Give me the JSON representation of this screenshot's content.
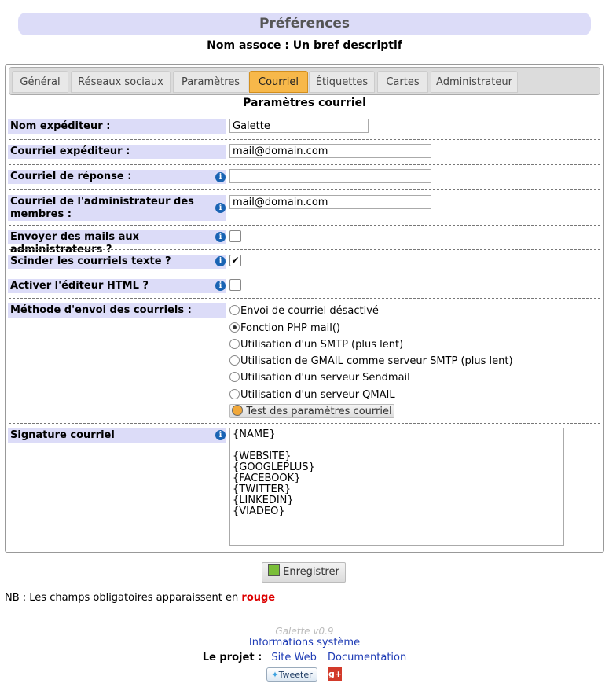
{
  "header": {
    "title": "Préférences",
    "assoc": "Nom assoce : Un bref descriptif"
  },
  "tabs": [
    "Général",
    "Réseaux sociaux",
    "Paramètres",
    "Courriel",
    "Étiquettes",
    "Cartes",
    "Administrateur"
  ],
  "active_tab": "Courriel",
  "section_title": "Paramètres courriel",
  "fields": {
    "sender_name": {
      "label": "Nom expéditeur :",
      "value": "Galette"
    },
    "sender_email": {
      "label": "Courriel expéditeur :",
      "value": "mail@domain.com"
    },
    "reply_to": {
      "label": "Courriel de réponse :",
      "value": ""
    },
    "admin_email": {
      "label": "Courriel de l'administrateur des membres :",
      "value": "mail@domain.com"
    },
    "mail_admins": {
      "label": "Envoyer des mails aux administrateurs ?",
      "checked": false
    },
    "wrap_text": {
      "label": "Scinder les courriels texte ?",
      "checked": true
    },
    "html_editor": {
      "label": "Activer l'éditeur HTML ?",
      "checked": false
    },
    "send_method": {
      "label": "Méthode d'envoi des courriels :",
      "options": [
        "Envoi de courriel désactivé",
        "Fonction PHP mail()",
        "Utilisation d'un SMTP (plus lent)",
        "Utilisation de GMAIL comme serveur SMTP (plus lent)",
        "Utilisation d'un serveur Sendmail",
        "Utilisation d'un serveur QMAIL"
      ],
      "selected": "Fonction PHP mail()"
    },
    "test_button": "Test des paramètres courriel",
    "signature": {
      "label": "Signature courriel",
      "value": "{NAME}\n\n{WEBSITE}\n{GOOGLEPLUS}\n{FACEBOOK}\n{TWITTER}\n{LINKEDIN}\n{VIADEO}"
    }
  },
  "save_button": "Enregistrer",
  "note": {
    "prefix": "NB : Les champs obligatoires apparaissent en ",
    "highlight": "rouge"
  },
  "footer": {
    "version": "Galette v0.9",
    "sysinfo": "Informations système",
    "project_label": "Le projet :",
    "website": "Site Web",
    "documentation": "Documentation",
    "tweet": "Tweeter"
  },
  "colors": {
    "tab_active": "#f7b84a",
    "label_bg": "#dcdcf8",
    "link": "#1f3cb5",
    "required": "#dd0000",
    "info_icon": "#1a64b4"
  }
}
